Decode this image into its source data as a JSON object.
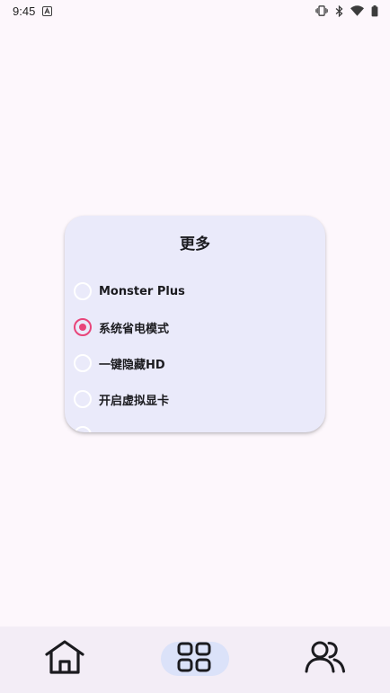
{
  "status_bar": {
    "time": "9:45",
    "icons": [
      "notification-a-icon",
      "vibrate-icon",
      "bluetooth-icon",
      "wifi-icon",
      "battery-icon"
    ]
  },
  "dialog": {
    "title": "更多",
    "options": [
      {
        "label": "Monster Plus",
        "checked": false
      },
      {
        "label": "系统省电模式",
        "checked": true
      },
      {
        "label": "一键隐藏HD",
        "checked": false
      },
      {
        "label": "开启虚拟显卡",
        "checked": false
      }
    ]
  },
  "bottom_nav": {
    "items": [
      {
        "icon": "home-icon",
        "active": false
      },
      {
        "icon": "grid-icon",
        "active": true
      },
      {
        "icon": "users-icon",
        "active": false
      }
    ]
  },
  "colors": {
    "background": "#fdf7fc",
    "dialog_background": "#eaeafa",
    "radio_accent": "#e8457a",
    "nav_background": "#f3edf6",
    "nav_active_pill": "#dbe2f9"
  }
}
